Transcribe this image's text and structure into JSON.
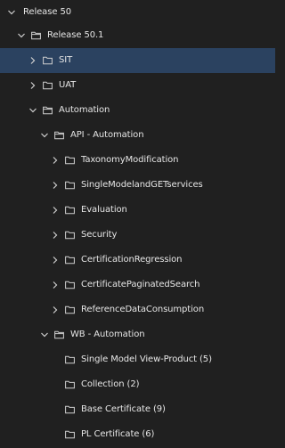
{
  "colors": {
    "background": "#202020",
    "selected_row": "#2b4260",
    "text": "#e6e6e6",
    "icon": "#cfcfcf"
  },
  "tree": {
    "items": [
      {
        "label": "Release 50",
        "expanded": true,
        "has_children": true,
        "selected": false
      },
      {
        "label": "Release 50.1",
        "expanded": true,
        "has_children": true,
        "selected": false
      },
      {
        "label": "SIT",
        "expanded": false,
        "has_children": true,
        "selected": true
      },
      {
        "label": "UAT",
        "expanded": false,
        "has_children": true,
        "selected": false
      },
      {
        "label": "Automation",
        "expanded": true,
        "has_children": true,
        "selected": false
      },
      {
        "label": "API - Automation",
        "expanded": true,
        "has_children": true,
        "selected": false
      },
      {
        "label": "TaxonomyModification",
        "expanded": false,
        "has_children": true,
        "selected": false
      },
      {
        "label": "SingleModelandGETservices",
        "expanded": false,
        "has_children": true,
        "selected": false
      },
      {
        "label": "Evaluation",
        "expanded": false,
        "has_children": true,
        "selected": false
      },
      {
        "label": "Security",
        "expanded": false,
        "has_children": true,
        "selected": false
      },
      {
        "label": "CertificationRegression",
        "expanded": false,
        "has_children": true,
        "selected": false
      },
      {
        "label": "CertificatePaginatedSearch",
        "expanded": false,
        "has_children": true,
        "selected": false
      },
      {
        "label": "ReferenceDataConsumption",
        "expanded": false,
        "has_children": true,
        "selected": false
      },
      {
        "label": "WB - Automation",
        "expanded": true,
        "has_children": true,
        "selected": false
      },
      {
        "label": "Single Model View-Product (5)",
        "expanded": false,
        "has_children": false,
        "selected": false
      },
      {
        "label": "Collection (2)",
        "expanded": false,
        "has_children": false,
        "selected": false
      },
      {
        "label": "Base Certificate (9)",
        "expanded": false,
        "has_children": false,
        "selected": false
      },
      {
        "label": "PL Certificate (6)",
        "expanded": false,
        "has_children": false,
        "selected": false
      }
    ]
  }
}
